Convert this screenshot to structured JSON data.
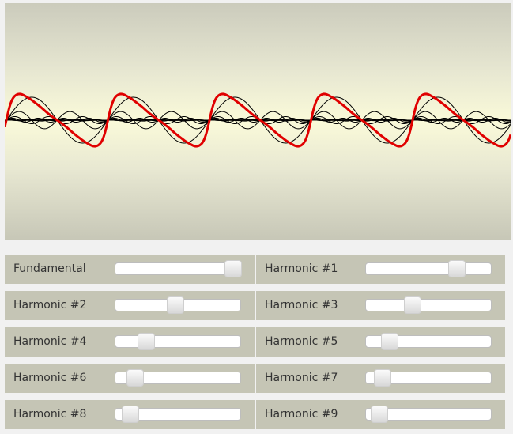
{
  "plot": {
    "wave_color": "#e00000",
    "harmonic_color": "#000000"
  },
  "sliders": [
    {
      "label": "Fundamental",
      "value": 1.0
    },
    {
      "label": "Harmonic #1",
      "value": 0.75
    },
    {
      "label": "Harmonic #2",
      "value": 0.47
    },
    {
      "label": "Harmonic #3",
      "value": 0.35
    },
    {
      "label": "Harmonic #4",
      "value": 0.2
    },
    {
      "label": "Harmonic #5",
      "value": 0.14
    },
    {
      "label": "Harmonic #6",
      "value": 0.1
    },
    {
      "label": "Harmonic #7",
      "value": 0.07
    },
    {
      "label": "Harmonic #8",
      "value": 0.06
    },
    {
      "label": "Harmonic #9",
      "value": 0.04
    }
  ]
}
